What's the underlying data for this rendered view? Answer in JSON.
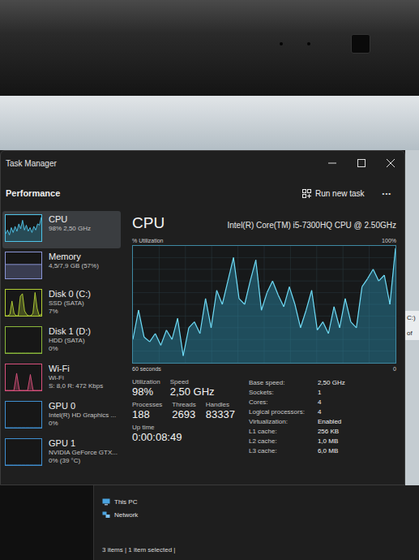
{
  "window": {
    "title": "Task Manager",
    "more": "•••"
  },
  "header": {
    "title": "Performance",
    "action": "Run new task"
  },
  "sidebar": {
    "items": [
      {
        "name": "CPU",
        "lines": [
          "98% 2,50 GHz"
        ],
        "selected": true,
        "color": "#4fc3e8",
        "graph": [
          30,
          45,
          25,
          55,
          35,
          60,
          40,
          70,
          50,
          85,
          45,
          65,
          40,
          55,
          35,
          60,
          45,
          70,
          65,
          98
        ]
      },
      {
        "name": "Memory",
        "lines": [
          "4,5/7,9 GB (57%)"
        ],
        "selected": false,
        "color": "#8a95d6",
        "graph": [
          57,
          57,
          57,
          57,
          57,
          57,
          57,
          57,
          57,
          57,
          57,
          57
        ]
      },
      {
        "name": "Disk 0 (C:)",
        "lines": [
          "SSD (SATA)",
          "7%"
        ],
        "selected": false,
        "color": "#b2cf35",
        "graph": [
          0,
          0,
          5,
          60,
          10,
          0,
          0,
          80,
          90,
          20,
          5,
          0,
          0,
          10,
          95,
          30,
          0,
          7
        ]
      },
      {
        "name": "Disk 1 (D:)",
        "lines": [
          "HDD (SATA)",
          "0%"
        ],
        "selected": false,
        "color": "#8ab83a",
        "graph": [
          0,
          0,
          0,
          0,
          0,
          0,
          0,
          0,
          0,
          0
        ]
      },
      {
        "name": "Wi-Fi",
        "lines": [
          "Wi-Fi",
          "S: 8,0 R: 472 Kbps"
        ],
        "selected": false,
        "color": "#d8507c",
        "graph": [
          0,
          0,
          0,
          0,
          70,
          0,
          0,
          0,
          0,
          65,
          0,
          0,
          0,
          0
        ]
      },
      {
        "name": "GPU 0",
        "lines": [
          "Intel(R) HD Graphics ...",
          "0%"
        ],
        "selected": false,
        "color": "#3f8fd0",
        "graph": [
          0,
          0,
          0,
          0,
          0,
          0,
          0,
          0,
          0,
          0
        ]
      },
      {
        "name": "GPU 1",
        "lines": [
          "NVIDIA GeForce GTX...",
          "0% (39 °C)"
        ],
        "selected": false,
        "color": "#3f8fd0",
        "graph": [
          0,
          0,
          0,
          0,
          0,
          0,
          0,
          0,
          0,
          0
        ]
      }
    ]
  },
  "cpu": {
    "title": "CPU",
    "model": "Intel(R) Core(TM) i5-7300HQ CPU @ 2.50GHz",
    "axis_label": "% Utilization",
    "max_label": "100%",
    "time_label": "60 seconds",
    "min_label": "0",
    "max": 100,
    "series": [
      20,
      45,
      22,
      18,
      25,
      15,
      28,
      20,
      38,
      6,
      30,
      35,
      25,
      55,
      30,
      62,
      50,
      70,
      90,
      55,
      50,
      70,
      88,
      45,
      60,
      70,
      58,
      48,
      65,
      50,
      30,
      45,
      62,
      28,
      35,
      25,
      48,
      30,
      55,
      35,
      30,
      65,
      72,
      80,
      70,
      75,
      50,
      98
    ]
  },
  "stats_rows": [
    [
      {
        "label": "Utilization",
        "value": "98%"
      },
      {
        "label": "Speed",
        "value": "2,50 GHz"
      }
    ],
    [
      {
        "label": "Processes",
        "value": "188"
      },
      {
        "label": "Threads",
        "value": "2693"
      },
      {
        "label": "Handles",
        "value": "83337"
      }
    ],
    [
      {
        "label": "Up time",
        "value": "0:00:08:49"
      }
    ]
  ],
  "specs": [
    {
      "label": "Base speed:",
      "value": "2,50 GHz"
    },
    {
      "label": "Sockets:",
      "value": "1"
    },
    {
      "label": "Cores:",
      "value": "4"
    },
    {
      "label": "Logical processors:",
      "value": "4"
    },
    {
      "label": "Virtualization:",
      "value": "Enabled"
    },
    {
      "label": "L1 cache:",
      "value": "256 KB"
    },
    {
      "label": "L2 cache:",
      "value": "1,0 MB"
    },
    {
      "label": "L3 cache:",
      "value": "6,0 MB"
    }
  ],
  "background": {
    "edge_texts": [
      "C:)",
      "of"
    ],
    "nav": [
      "This PC",
      "Network"
    ],
    "status": "3 items | 1 item selected |"
  }
}
